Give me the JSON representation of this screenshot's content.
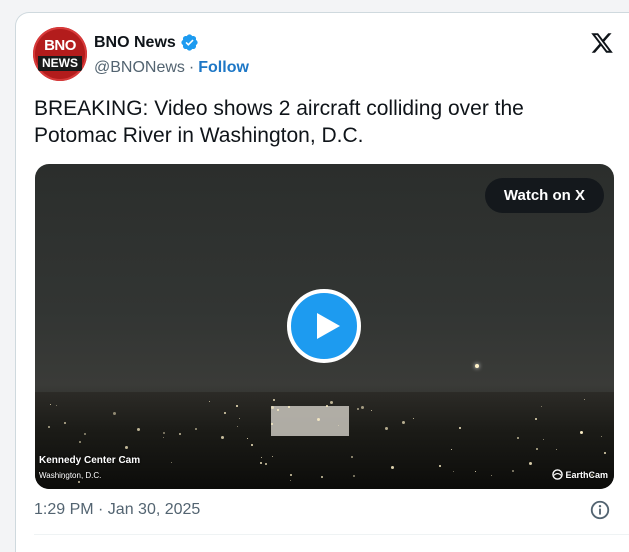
{
  "account": {
    "avatar_top": "BNO",
    "avatar_bottom": "NEWS",
    "name": "BNO News",
    "handle": "@BNONews",
    "separator": "·",
    "follow_label": "Follow"
  },
  "tweet": {
    "text": "BREAKING: Video shows 2 aircraft colliding over the Potomac River in Washington, D.C.",
    "timestamp": "1:29 PM · Jan 30, 2025"
  },
  "media": {
    "watch_label": "Watch on X",
    "cam_name": "Kennedy Center Cam",
    "cam_location": "Washington, D.C.",
    "watermark": "EarthCam"
  },
  "icons": {
    "verified": "verified-badge-icon",
    "x_logo": "x-logo-icon",
    "play": "play-icon",
    "info": "info-icon"
  },
  "colors": {
    "accent": "#1d9bf0",
    "follow": "#1d77c6",
    "avatar_bg": "#b31c1c",
    "text_primary": "#0f1419",
    "text_secondary": "#536471"
  }
}
